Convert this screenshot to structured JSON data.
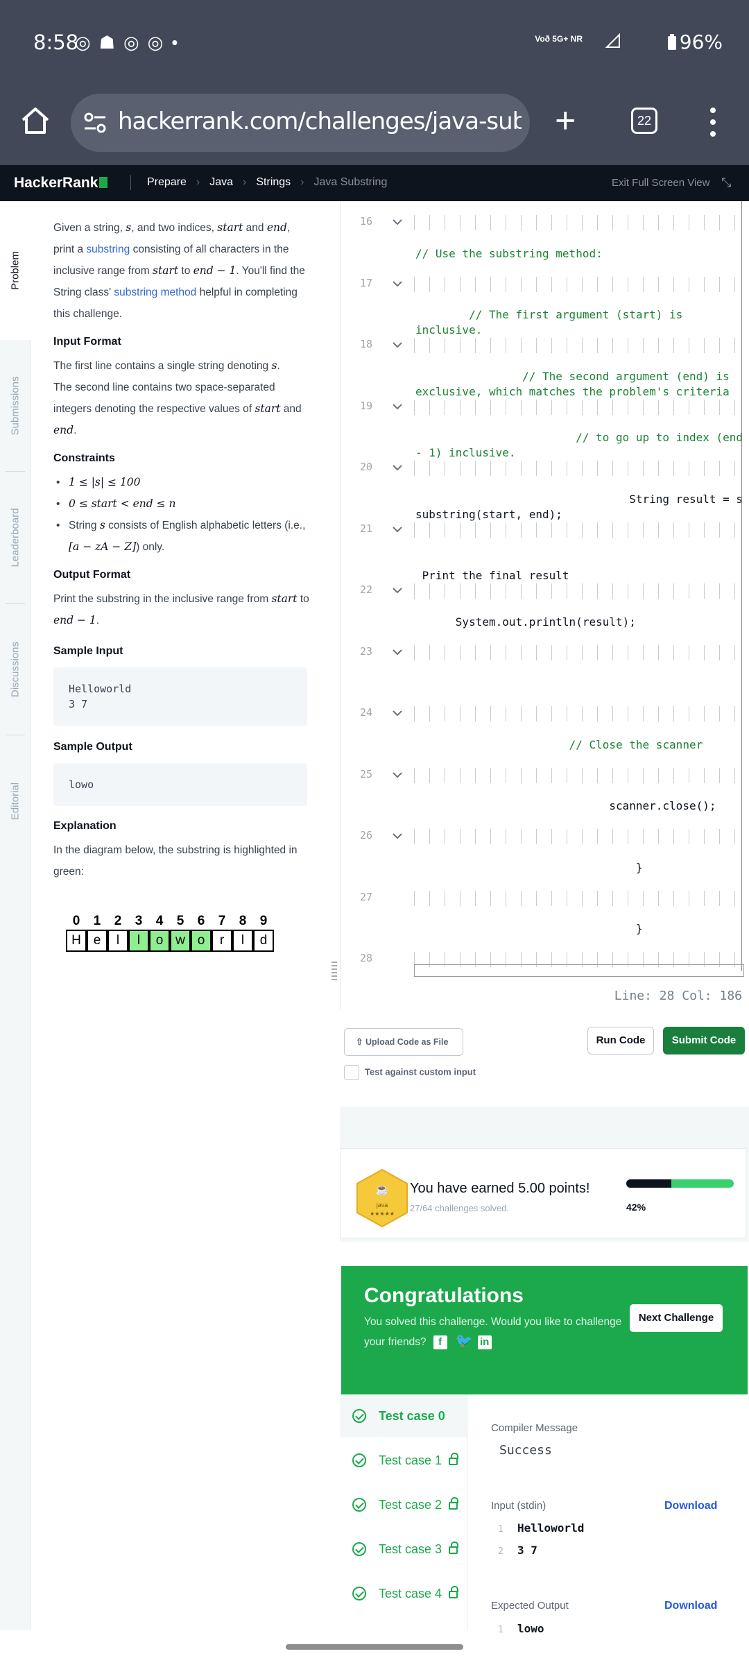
{
  "status_bar": {
    "time": "8:58",
    "network_label": "Voð 5G+ NR",
    "battery": "96%"
  },
  "browser": {
    "url": "hackerrank.com/challenges/java-substring/p",
    "tab_count": "22"
  },
  "topnav": {
    "logo": "HackerRank",
    "crumbs": [
      "Prepare",
      "Java",
      "Strings",
      "Java Substring"
    ],
    "exit_label": "Exit Full Screen View"
  },
  "side_tabs": [
    "Problem",
    "Submissions",
    "Leaderboard",
    "Discussions",
    "Editorial"
  ],
  "problem": {
    "intro": {
      "t1": "Given a string, ",
      "s": "s",
      "t2": ", and two indices, ",
      "start": "start",
      "t3": " and ",
      "end": "end",
      "t4": ", print a ",
      "link1": "substring",
      "t5": " consisting of all characters in the inclusive range from ",
      "t6": " to ",
      "endm1": "end − 1",
      "t7": ". You'll find the String class' ",
      "link2": "substring method",
      "t8": " helpful in completing this challenge."
    },
    "input_format_title": "Input Format",
    "input_format": {
      "l1a": "The first line contains a single string denoting ",
      "l1b": ".",
      "l2a": "The second line contains two space-separated integers denoting the respective values of ",
      "l2b": " and ",
      "l2c": "."
    },
    "constraints_title": "Constraints",
    "constraints": {
      "c1": "1 ≤ |s| ≤ 100",
      "c2": "0 ≤ start < end ≤ n",
      "c3a": "String ",
      "c3b": " consists of English alphabetic letters (i.e., ",
      "c3c": "[a − zA − Z]",
      "c3d": ") only."
    },
    "output_format_title": "Output Format",
    "output_format": {
      "a": "Print the substring in the inclusive range from ",
      "b": " to "
    },
    "sample_input_title": "Sample Input",
    "sample_input": "Helloworld\n3 7",
    "sample_output_title": "Sample Output",
    "sample_output": "lowo",
    "explanation_title": "Explanation",
    "explanation": "In the diagram below, the substring is highlighted in green:",
    "diagram": {
      "indices": [
        "0",
        "1",
        "2",
        "3",
        "4",
        "5",
        "6",
        "7",
        "8",
        "9"
      ],
      "letters": [
        "H",
        "e",
        "l",
        "l",
        "o",
        "w",
        "o",
        "r",
        "l",
        "d"
      ],
      "highlight_from": 3,
      "highlight_to": 6
    }
  },
  "editor": {
    "lines": [
      {
        "n": "16",
        "text": ""
      },
      {
        "n": "17",
        "text": "// Use the substring method:"
      },
      {
        "n": "18",
        "text": "        // The first argument (start) is\ninclusive."
      },
      {
        "n": "19",
        "text": "                // The second argument (end) is\nexclusive, which matches the problem's criteria"
      },
      {
        "n": "20",
        "text": "                        // to go up to index (end\n- 1) inclusive."
      },
      {
        "n": "21",
        "text": "                                String result = s\nsubstring(start, end);"
      },
      {
        "n": "22",
        "text": "                                                    /\n Print the final result"
      },
      {
        "n": "23",
        "text": "      System.out.println(result);"
      },
      {
        "n": "24",
        "text": ""
      },
      {
        "n": "25",
        "text": "                       // Close the scanner"
      },
      {
        "n": "26",
        "text": "                             scanner.close();"
      },
      {
        "n": "27",
        "text": "                                 }"
      },
      {
        "n": "28",
        "text": "                                 }"
      }
    ],
    "status": "Line: 28 Col: 186"
  },
  "actions": {
    "upload": "Upload Code as File",
    "run": "Run Code",
    "submit": "Submit Code",
    "custom_input": "Test against custom input"
  },
  "points": {
    "badge_label": "java",
    "earned": "You have earned 5.00 points!",
    "solved": "27/64 challenges solved.",
    "progress_pct_label": "42%",
    "progress_fraction": 0.42
  },
  "congrats": {
    "title": "Congratulations",
    "message": "You solved this challenge. Would you like to challenge your friends?",
    "next": "Next Challenge"
  },
  "tests": {
    "cases": [
      "Test case 0",
      "Test case 1",
      "Test case 2",
      "Test case 3",
      "Test case 4"
    ],
    "compiler_label": "Compiler Message",
    "compiler_message": "Success",
    "input_label": "Input (stdin)",
    "input_lines": [
      "Helloworld",
      "3 7"
    ],
    "download": "Download",
    "expected_label": "Expected Output",
    "expected_lines": [
      "lowo"
    ]
  },
  "colors": {
    "accent_green": "#1ba94c",
    "link_blue": "#3366cc",
    "nav_dark": "#0e141e"
  }
}
